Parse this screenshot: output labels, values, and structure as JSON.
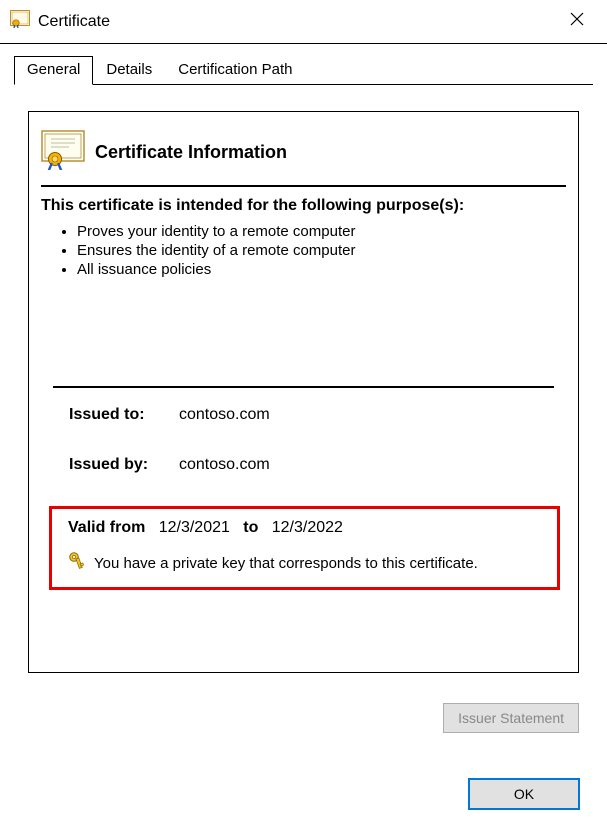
{
  "window": {
    "title": "Certificate"
  },
  "tabs": {
    "general": "General",
    "details": "Details",
    "certpath": "Certification Path"
  },
  "header": {
    "title": "Certificate Information"
  },
  "purpose": {
    "heading": "This certificate is intended for the following purpose(s):",
    "items": [
      "Proves your identity to a remote computer",
      "Ensures the identity of a remote computer",
      "All issuance policies"
    ]
  },
  "issued": {
    "to_label": "Issued to:",
    "to_value": "contoso.com",
    "by_label": "Issued by:",
    "by_value": "contoso.com"
  },
  "validity": {
    "from_label": "Valid from",
    "from_value": "12/3/2021",
    "to_label": "to",
    "to_value": "12/3/2022"
  },
  "private_key_note": "You have a private key that corresponds to this certificate.",
  "buttons": {
    "issuer_statement": "Issuer Statement",
    "ok": "OK"
  }
}
